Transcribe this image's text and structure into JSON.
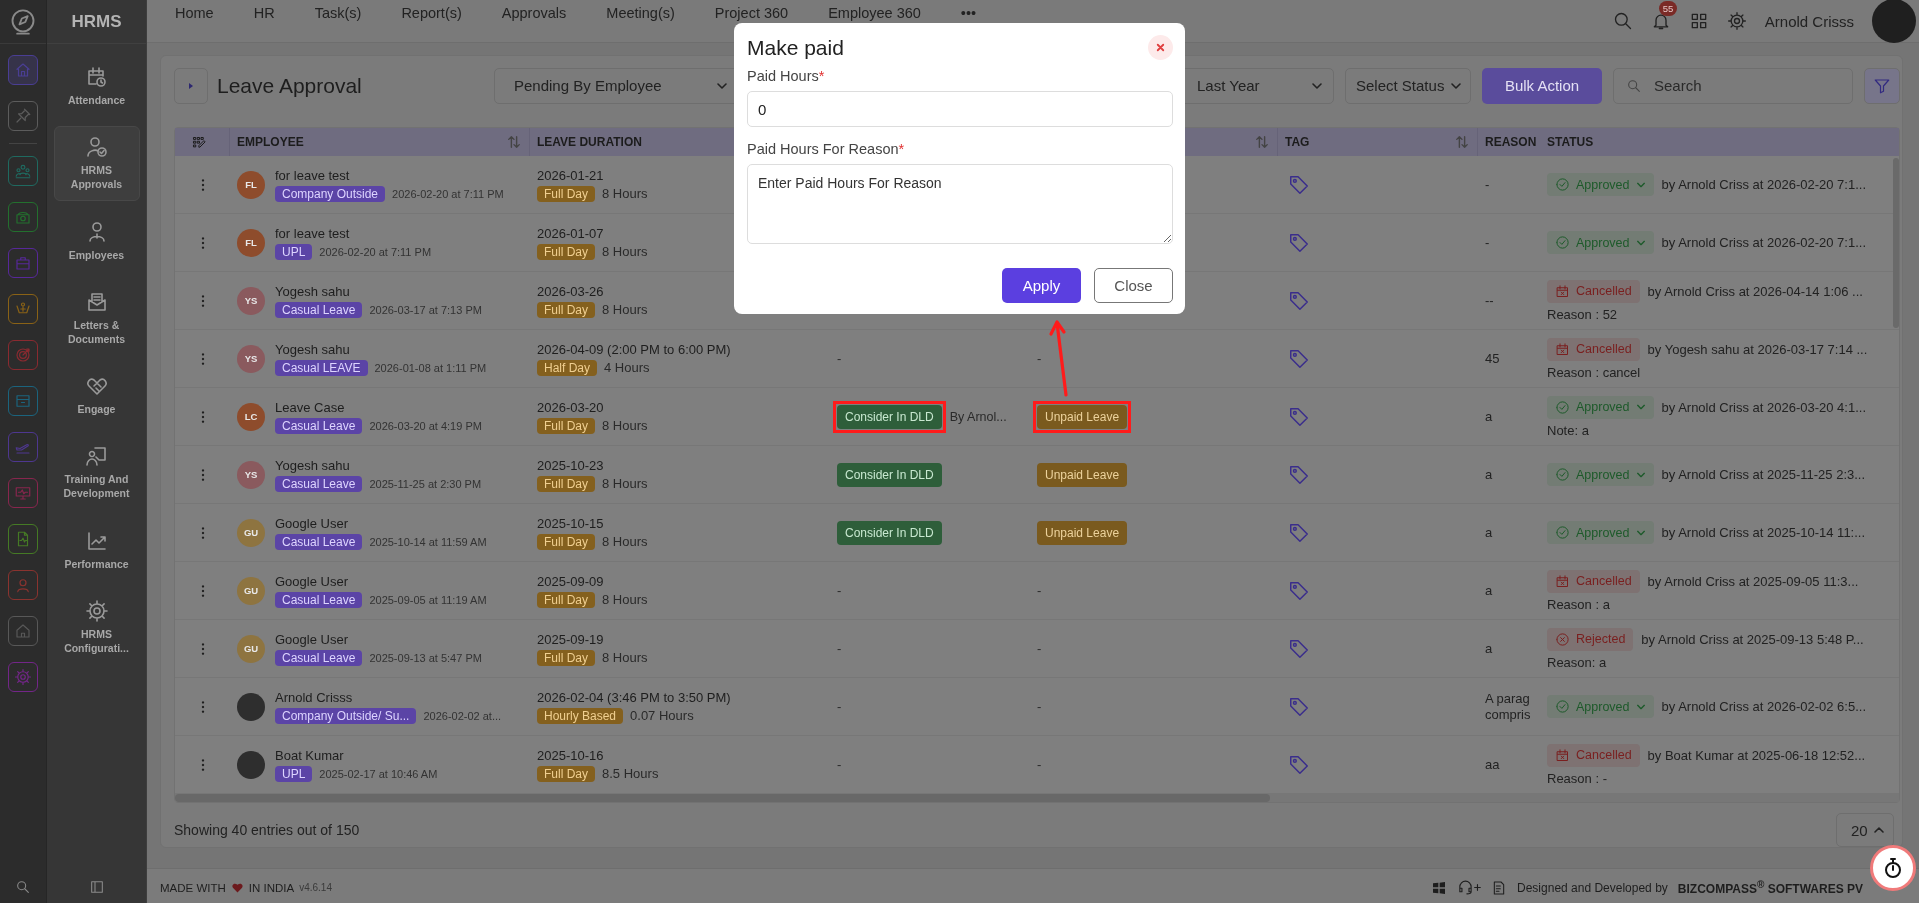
{
  "rail": {
    "items": [
      {
        "color": "#4a3e94",
        "selected": true
      },
      {
        "color": "#5c5c5c",
        "selected": false
      },
      {
        "color": "#1f6a60",
        "selected": false
      },
      {
        "color": "#23702e",
        "selected": false
      },
      {
        "color": "#57289a",
        "selected": false
      },
      {
        "color": "#8a6216",
        "selected": false
      },
      {
        "color": "#8a2a30",
        "selected": false
      },
      {
        "color": "#1b647e",
        "selected": false
      },
      {
        "color": "#4e3790",
        "selected": false
      },
      {
        "color": "#88264e",
        "selected": false
      },
      {
        "color": "#457a25",
        "selected": false
      },
      {
        "color": "#8a332f",
        "selected": false
      },
      {
        "color": "#585858",
        "selected": false
      },
      {
        "color": "#732688",
        "selected": false
      }
    ]
  },
  "sidebar": {
    "title": "HRMS",
    "items": [
      {
        "label": "Attendance",
        "selected": false
      },
      {
        "label": "HRMS Approvals",
        "selected": true
      },
      {
        "label": "Employees",
        "selected": false
      },
      {
        "label": "Letters & Documents",
        "selected": false
      },
      {
        "label": "Engage",
        "selected": false
      },
      {
        "label": "Training And Development",
        "selected": false
      },
      {
        "label": "Performance",
        "selected": false
      },
      {
        "label": "HRMS Configurati...",
        "selected": false
      }
    ]
  },
  "topnav": {
    "items": [
      "Home",
      "HR",
      "Task(s)",
      "Report(s)",
      "Approvals",
      "Meeting(s)",
      "Project 360",
      "Employee 360"
    ],
    "more": "•••",
    "notifications": "55",
    "user": "Arnold Crisss"
  },
  "page": {
    "title": "Leave Approval",
    "filters": [
      {
        "value": "Pending By Employee"
      },
      {
        "value": "Last Year"
      },
      {
        "value": "Select Status"
      }
    ],
    "bulk_action": "Bulk Action",
    "search": {
      "placeholder": "Search"
    }
  },
  "table": {
    "columns": [
      {
        "label": "EMPLOYEE",
        "sortable": true
      },
      {
        "label": "LEAVE DURATION"
      },
      {},
      {
        "sortable": true
      },
      {
        "label": "TAG",
        "sortable": true
      },
      {
        "label": "REASON"
      },
      {
        "label": "STATUS"
      }
    ],
    "rows": [
      {
        "avatar": {
          "kind": "initials",
          "initials": "FL",
          "color": "#8e4c2c"
        },
        "name": "for leave test",
        "leave_type": "Company Outside",
        "applied": "2026-02-20 at 7:11 PM",
        "date": "2026-01-21",
        "day_type": "Full Day",
        "hours": "8 Hours",
        "reason": "-",
        "status": {
          "kind": "approved",
          "label": "Approved",
          "by": "by Arnold Criss at 2026-02-20 7:1..."
        }
      },
      {
        "avatar": {
          "kind": "initials",
          "initials": "FL",
          "color": "#8e4c2c"
        },
        "name": "for leave test",
        "leave_type": "UPL",
        "applied": "2026-02-20 at 7:11 PM",
        "date": "2026-01-07",
        "day_type": "Full Day",
        "hours": "8 Hours",
        "reason": "-",
        "status": {
          "kind": "approved",
          "label": "Approved",
          "by": "by Arnold Criss at 2026-02-20 7:1..."
        }
      },
      {
        "avatar": {
          "kind": "initials",
          "initials": "YS",
          "color": "#8a5a5e"
        },
        "name": "Yogesh sahu",
        "leave_type": "Casual Leave",
        "applied": "2026-03-17 at 7:13 PM",
        "date": "2026-03-26",
        "day_type": "Full Day",
        "hours": "8 Hours",
        "reason": "--",
        "status": {
          "kind": "cancelled",
          "label": "Cancelled",
          "by": "by Arnold Criss at 2026-04-14 1:06 ...",
          "note": "Reason : 52"
        }
      },
      {
        "avatar": {
          "kind": "initials",
          "initials": "YS",
          "color": "#8a5a5e"
        },
        "name": "Yogesh sahu",
        "leave_type": "Casual LEAVE",
        "applied": "2026-01-08 at 1:11 PM",
        "date": "2026-04-09 (2:00 PM to 6:00 PM)",
        "day_type": "Half Day",
        "hours": "4 Hours",
        "col4": {
          "kind": "dash",
          "text": "-"
        },
        "col5": {
          "kind": "dash",
          "text": "-"
        },
        "reason": "45",
        "status": {
          "kind": "cancelled",
          "label": "Cancelled",
          "by": "by Yogesh sahu at 2026-03-17 7:14 ...",
          "note": "Reason : cancel"
        }
      },
      {
        "avatar": {
          "kind": "initials",
          "initials": "LC",
          "color": "#8e4c2c"
        },
        "name": "Leave Case",
        "leave_type": "Casual Leave",
        "applied": "2026-03-20 at 4:19 PM",
        "date": "2026-03-20",
        "day_type": "Full Day",
        "hours": "8 Hours",
        "col4": {
          "kind": "badge",
          "text": "Consider In DLD",
          "by": "By Arnol...",
          "highlighted": true
        },
        "col5": {
          "kind": "badge",
          "text": "Unpaid Leave",
          "highlighted": true
        },
        "reason": "a",
        "status": {
          "kind": "approved",
          "label": "Approved",
          "by": "by Arnold Criss at 2026-03-20 4:1...",
          "note": "Note:  a"
        }
      },
      {
        "avatar": {
          "kind": "initials",
          "initials": "YS",
          "color": "#8a5a5e"
        },
        "name": "Yogesh sahu",
        "leave_type": "Casual Leave",
        "applied": "2025-11-25 at 2:30 PM",
        "date": "2025-10-23",
        "day_type": "Full Day",
        "hours": "8 Hours",
        "col4": {
          "kind": "badge",
          "text": "Consider In DLD"
        },
        "col5": {
          "kind": "badge",
          "text": "Unpaid Leave"
        },
        "reason": "a",
        "status": {
          "kind": "approved",
          "label": "Approved",
          "by": "by Arnold Criss at 2025-11-25 2:3..."
        }
      },
      {
        "avatar": {
          "kind": "initials",
          "initials": "GU",
          "color": "#8e7440"
        },
        "name": "Google User",
        "leave_type": "Casual Leave",
        "applied": "2025-10-14 at 11:59 AM",
        "date": "2025-10-15",
        "day_type": "Full Day",
        "hours": "8 Hours",
        "col4": {
          "kind": "badge",
          "text": "Consider In DLD"
        },
        "col5": {
          "kind": "badge",
          "text": "Unpaid Leave"
        },
        "reason": "a",
        "status": {
          "kind": "approved",
          "label": "Approved",
          "by": "by Arnold Criss at 2025-10-14 11:..."
        }
      },
      {
        "avatar": {
          "kind": "initials",
          "initials": "GU",
          "color": "#8e7440"
        },
        "name": "Google User",
        "leave_type": "Casual Leave",
        "applied": "2025-09-05 at 11:19 AM",
        "date": "2025-09-09",
        "day_type": "Full Day",
        "hours": "8 Hours",
        "col4": {
          "kind": "dash",
          "text": "-"
        },
        "col5": {
          "kind": "dash",
          "text": "-"
        },
        "reason": "a",
        "status": {
          "kind": "cancelled",
          "label": "Cancelled",
          "by": "by Arnold Criss at 2025-09-05 11:3...",
          "note": "Reason : a"
        }
      },
      {
        "avatar": {
          "kind": "initials",
          "initials": "GU",
          "color": "#8e7440"
        },
        "name": "Google User",
        "leave_type": "Casual Leave",
        "applied": "2025-09-13 at 5:47 PM",
        "date": "2025-09-19",
        "day_type": "Full Day",
        "hours": "8 Hours",
        "col4": {
          "kind": "dash",
          "text": "-"
        },
        "col5": {
          "kind": "dash",
          "text": "-"
        },
        "reason": "a",
        "status": {
          "kind": "rejected",
          "label": "Rejected",
          "by": "by Arnold Criss at 2025-09-13 5:48 P...",
          "note": "Reason: a"
        }
      },
      {
        "avatar": {
          "kind": "photo"
        },
        "name": "Arnold Crisss",
        "leave_type": "Company Outside/ Su...",
        "applied": "2026-02-02 at...",
        "date": "2026-02-04 (3:46 PM to 3:50 PM)",
        "day_type": "Hourly Based",
        "hours": "0.07 Hours",
        "col4": {
          "kind": "dash",
          "text": "-"
        },
        "col5": {
          "kind": "dash",
          "text": "-"
        },
        "reason": "A parag\ncompris",
        "status": {
          "kind": "approved",
          "label": "Approved",
          "by": "by Arnold Criss at 2026-02-02 6:5..."
        }
      },
      {
        "avatar": {
          "kind": "photo"
        },
        "name": "Boat Kumar",
        "leave_type": "UPL",
        "applied": "2025-02-17 at 10:46 AM",
        "date": "2025-10-16",
        "day_type": "Full Day",
        "hours": "8.5 Hours",
        "col4": {
          "kind": "dash",
          "text": "-"
        },
        "col5": {
          "kind": "dash",
          "text": "-"
        },
        "reason": "aa",
        "status": {
          "kind": "cancelled",
          "label": "Cancelled",
          "by": "by Boat Kumar at 2025-06-18 12:52...",
          "note": "Reason : -"
        }
      }
    ]
  },
  "pagination": {
    "summary": "Showing 40 entries out of 150",
    "page_size": "20"
  },
  "footer": {
    "made_with": "MADE WITH",
    "in_india": "IN INDIA",
    "version": "v4.6.14",
    "designed_by": "Designed and Developed by",
    "company": "BIZCOMPASS$^{®}$ SOFTWARES PV"
  },
  "modal": {
    "title": "Make paid",
    "fields": [
      {
        "kind": "input",
        "label": "Paid Hours",
        "required_mark": "*",
        "value": "0"
      },
      {
        "kind": "textarea",
        "label": "Paid Hours For Reason",
        "required_mark": "*",
        "placeholder": "Enter Paid Hours For Reason"
      }
    ],
    "apply": "Apply",
    "close": "Close"
  }
}
